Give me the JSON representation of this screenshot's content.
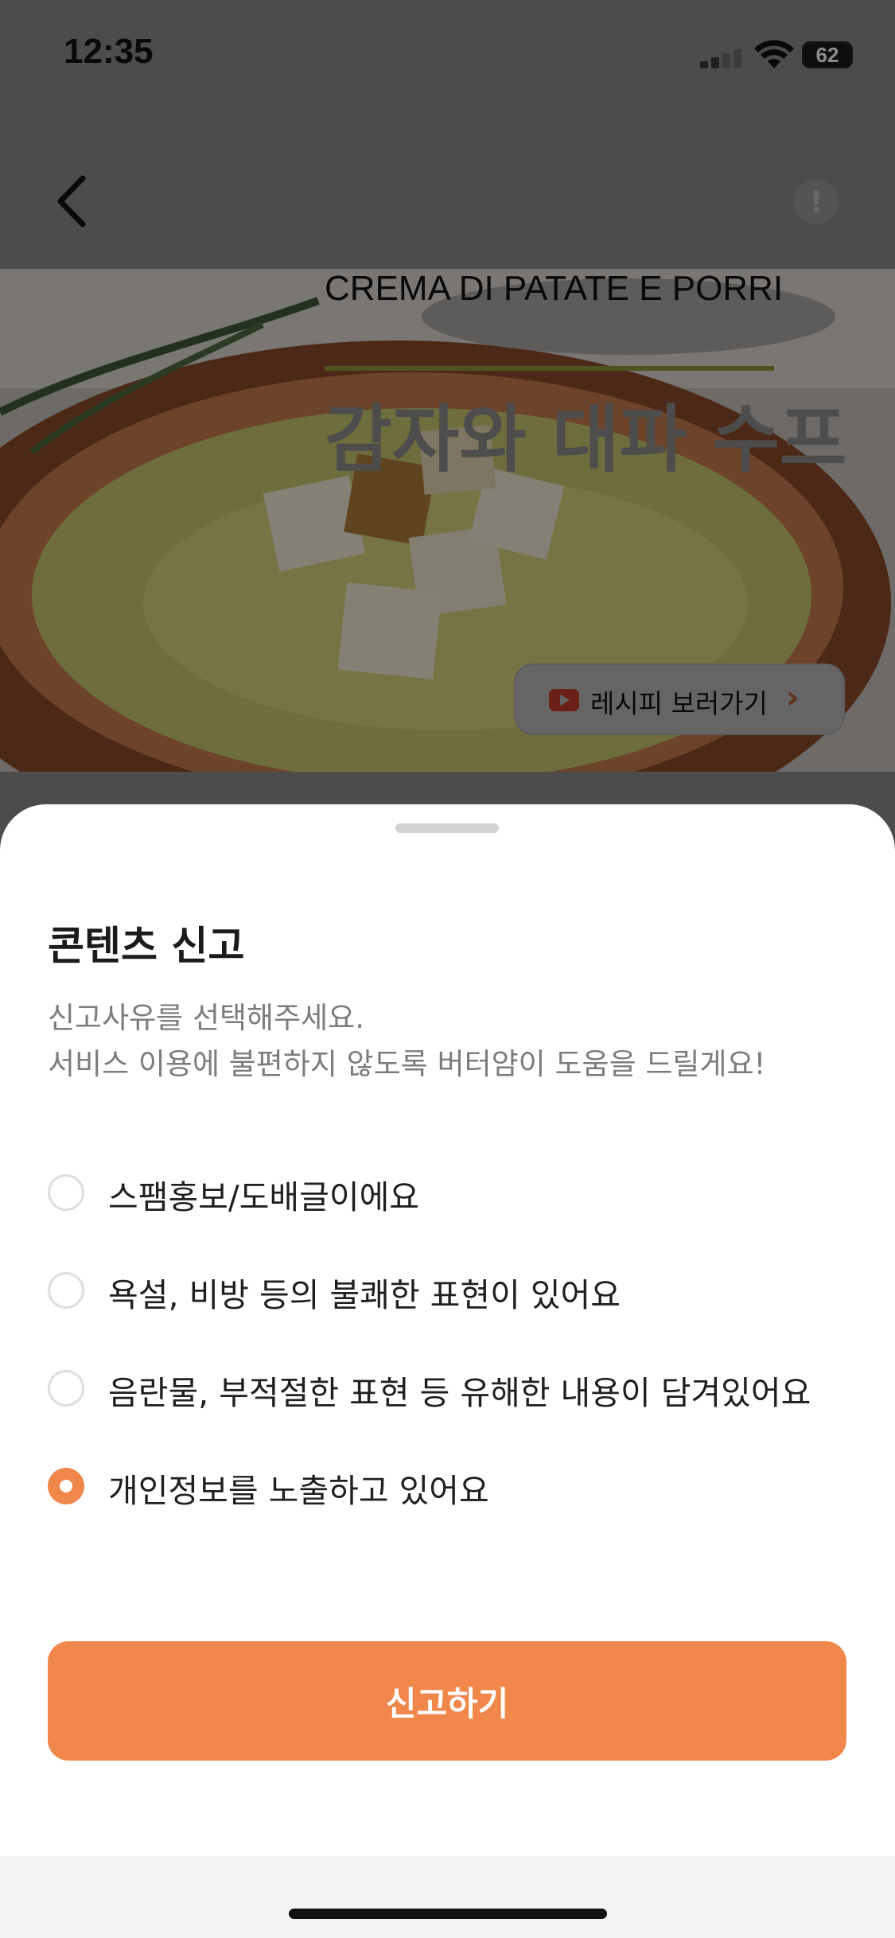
{
  "status_bar": {
    "time": "12:35",
    "battery": "62"
  },
  "hero": {
    "subtitle": "CREMA DI PATATE E PORRI",
    "title": "감자와 대파 수프",
    "recipe_button": "레시피 보러가기"
  },
  "sheet": {
    "title": "콘텐츠 신고",
    "description_lines": [
      "신고사유를 선택해주세요.",
      "서비스 이용에 불편하지 않도록 버터얌이 도움을 드릴게요!"
    ],
    "options": [
      {
        "label": "스팸홍보/도배글이에요",
        "selected": false
      },
      {
        "label": "욕설, 비방 등의 불쾌한 표현이 있어요",
        "selected": false
      },
      {
        "label": "음란물, 부적절한 표현 등 유해한 내용이 담겨있어요",
        "selected": false
      },
      {
        "label": "개인정보를 노출하고 있어요",
        "selected": true
      }
    ],
    "submit_label": "신고하기"
  },
  "colors": {
    "accent": "#F0874B",
    "backdrop": "#8A8A8A"
  }
}
